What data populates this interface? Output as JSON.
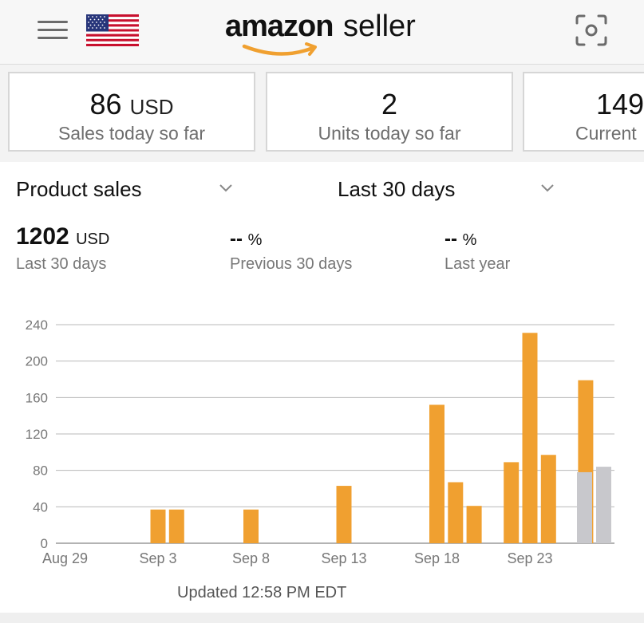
{
  "header": {
    "brand_amazon": "amazon",
    "brand_seller": "seller",
    "flag": "us-flag-icon",
    "menu_icon": "hamburger-menu-icon",
    "scan_icon": "camera-scan-icon"
  },
  "cards": [
    {
      "value": "86",
      "unit": "USD",
      "label": "Sales today so far"
    },
    {
      "value": "2",
      "unit": "",
      "label": "Units today so far"
    },
    {
      "value": "149",
      "unit": "",
      "label": "Current"
    }
  ],
  "selectors": {
    "metric": "Product sales",
    "range": "Last 30 days"
  },
  "metrics": [
    {
      "value": "1202",
      "unit": "USD",
      "label": "Last 30 days"
    },
    {
      "value": "--",
      "unit": "%",
      "label": "Previous 30 days"
    },
    {
      "value": "--",
      "unit": "%",
      "label": "Last year"
    }
  ],
  "chart_data": {
    "type": "bar",
    "title": "",
    "xlabel": "",
    "ylabel": "",
    "ylim": [
      0,
      240
    ],
    "yticks": [
      0,
      40,
      80,
      120,
      160,
      200,
      240
    ],
    "xtick_labels": [
      "Aug 29",
      "Sep 3",
      "Sep 8",
      "Sep 13",
      "Sep 18",
      "Sep 23"
    ],
    "categories": [
      "Aug 29",
      "Aug 30",
      "Aug 31",
      "Sep 1",
      "Sep 2",
      "Sep 3",
      "Sep 4",
      "Sep 5",
      "Sep 6",
      "Sep 7",
      "Sep 8",
      "Sep 9",
      "Sep 10",
      "Sep 11",
      "Sep 12",
      "Sep 13",
      "Sep 14",
      "Sep 15",
      "Sep 16",
      "Sep 17",
      "Sep 18",
      "Sep 19",
      "Sep 20",
      "Sep 21",
      "Sep 22",
      "Sep 23",
      "Sep 24",
      "Sep 25",
      "Sep 26",
      "Sep 27"
    ],
    "series": [
      {
        "color": "#f0a030",
        "values": [
          0,
          0,
          0,
          0,
          0,
          37,
          37,
          0,
          0,
          0,
          37,
          0,
          0,
          0,
          0,
          63,
          0,
          0,
          0,
          0,
          152,
          67,
          41,
          0,
          89,
          231,
          97,
          0,
          179,
          0
        ]
      },
      {
        "color": "#c8c8cc",
        "values": [
          0,
          0,
          0,
          0,
          0,
          0,
          0,
          0,
          0,
          0,
          0,
          0,
          0,
          0,
          0,
          0,
          0,
          0,
          0,
          0,
          0,
          0,
          0,
          0,
          0,
          0,
          0,
          0,
          0,
          78
        ]
      },
      {
        "color": "#c8c8cc",
        "values": [
          0,
          0,
          0,
          0,
          0,
          0,
          0,
          0,
          0,
          0,
          0,
          0,
          0,
          0,
          0,
          0,
          0,
          0,
          0,
          0,
          0,
          0,
          0,
          0,
          0,
          0,
          0,
          0,
          0,
          84
        ]
      }
    ],
    "grid": true,
    "legend": "none"
  },
  "updated": "Updated 12:58 PM EDT"
}
